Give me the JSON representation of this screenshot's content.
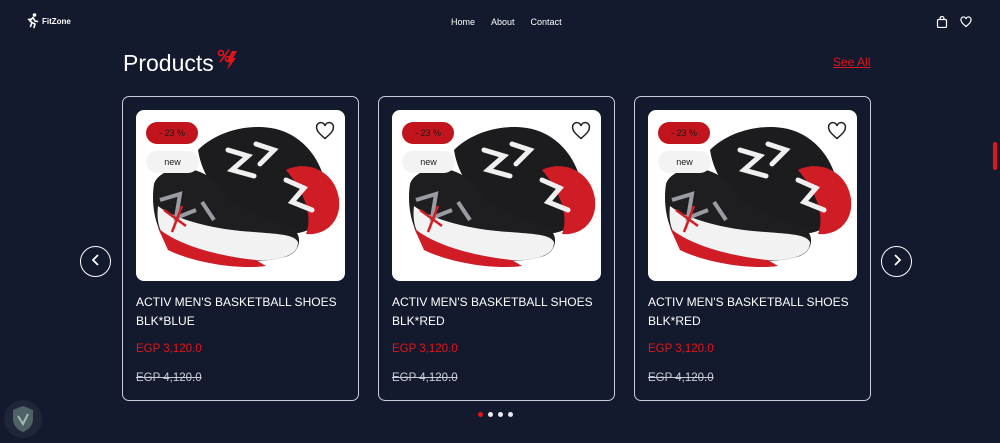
{
  "brand": {
    "name": "FitZone",
    "accent": "#e0141b",
    "background": "#141a2e"
  },
  "nav": {
    "links": [
      {
        "label": "Home"
      },
      {
        "label": "About"
      },
      {
        "label": "Contact"
      }
    ],
    "icons": [
      "shopping-bag-icon",
      "heart-icon"
    ]
  },
  "section": {
    "title": "Products",
    "see_all": "See All"
  },
  "products": [
    {
      "name": "ACTIV MEN'S BASKETBALL SHOES BLK*BLUE",
      "discount": "- 23 %",
      "badge": "new",
      "price": "EGP 3,120.0",
      "old_price": "EGP 4,120.0"
    },
    {
      "name": "ACTIV MEN'S BASKETBALL SHOES BLK*RED",
      "discount": "- 23 %",
      "badge": "new",
      "price": "EGP 3,120.0",
      "old_price": "EGP 4,120.0"
    },
    {
      "name": "ACTIV MEN'S BASKETBALL SHOES BLK*RED",
      "discount": "- 23 %",
      "badge": "new",
      "price": "EGP 3,120.0",
      "old_price": "EGP 4,120.0"
    }
  ],
  "carousel": {
    "dot_count": 4,
    "active_dot": 1
  }
}
